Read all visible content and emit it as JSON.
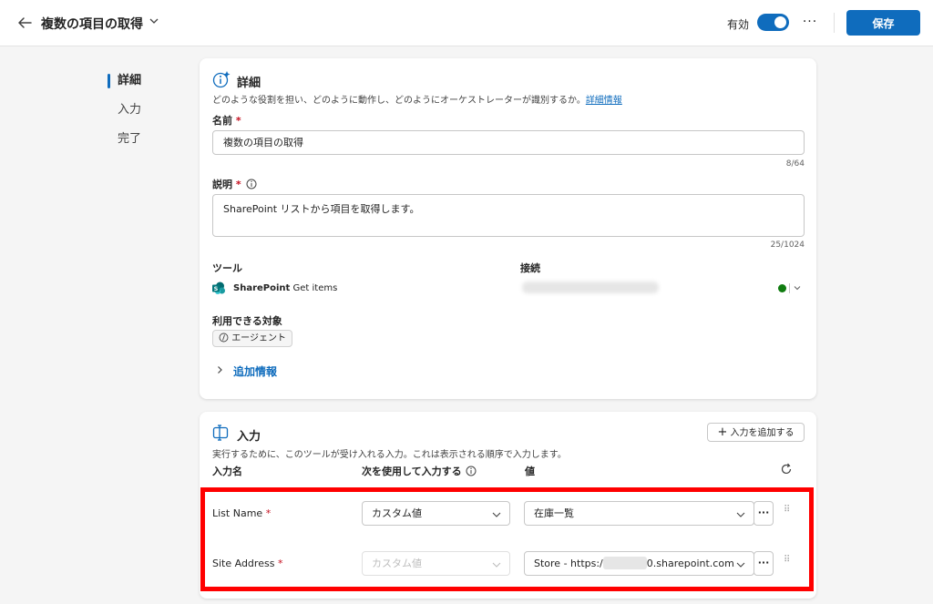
{
  "header": {
    "title": "複数の項目の取得",
    "enabled_label": "有効",
    "more_label": "···",
    "save_label": "保存"
  },
  "nav": {
    "items": [
      {
        "label": "詳細",
        "active": true
      },
      {
        "label": "入力",
        "active": false
      },
      {
        "label": "完了",
        "active": false
      }
    ]
  },
  "details": {
    "title": "詳細",
    "description": "どのような役割を担い、どのように動作し、どのようにオーケストレーターが識別するか。",
    "learn_more": "詳細情報",
    "name_label": "名前",
    "name_value": "複数の項目の取得",
    "name_counter": "8/64",
    "desc_label": "説明",
    "desc_value": "SharePoint リストから項目を取得します。",
    "desc_counter": "25/1024",
    "tool_label": "ツール",
    "tool_name": "SharePoint",
    "tool_action": "Get items",
    "connection_label": "接続",
    "available_label": "利用できる対象",
    "available_badge": "エージェント",
    "additional_info": "追加情報"
  },
  "inputs": {
    "title": "入力",
    "add_button": "入力を追加する",
    "description": "実行するために、このツールが受け入れる入力。これは表示される順序で入力します。",
    "col_name": "入力名",
    "col_fill": "次を使用して入力する",
    "col_value": "値",
    "rows": [
      {
        "name": "List Name",
        "fill": "カスタム値",
        "fill_disabled": false,
        "value": "在庫一覧"
      },
      {
        "name": "Site Address",
        "fill": "カスタム値",
        "fill_disabled": true,
        "value_prefix": "Store - https:/",
        "value_suffix": "0.sharepoint.com..."
      }
    ]
  },
  "colors": {
    "accent": "#0f6cbd",
    "required": "#c50f1f",
    "highlight": "#ff0000",
    "connected": "#107c10"
  }
}
